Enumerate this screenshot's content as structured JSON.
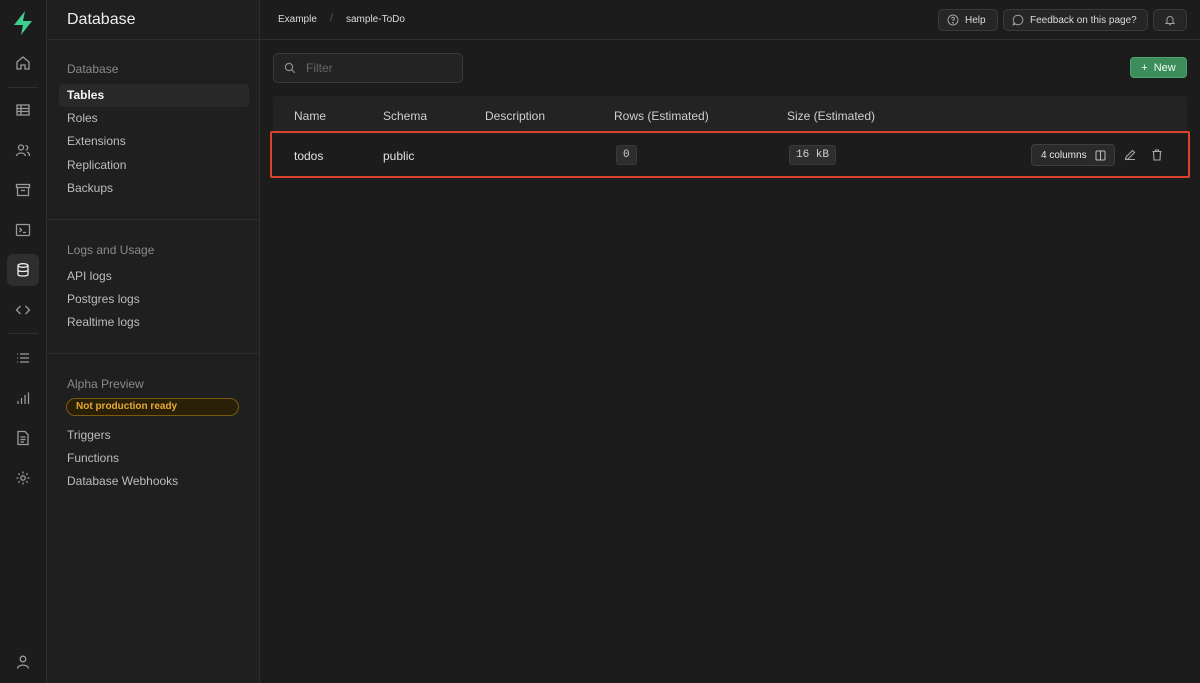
{
  "header": {
    "breadcrumb": [
      "Example",
      "sample-ToDo"
    ],
    "help_label": "Help",
    "feedback_label": "Feedback on this page?"
  },
  "sidebar": {
    "title": "Database",
    "sections": [
      {
        "title": "Database",
        "items": [
          "Tables",
          "Roles",
          "Extensions",
          "Replication",
          "Backups"
        ],
        "active": "Tables"
      },
      {
        "title": "Logs and Usage",
        "items": [
          "API logs",
          "Postgres logs",
          "Realtime logs"
        ]
      },
      {
        "title": "Alpha Preview",
        "badge": "Not production ready",
        "items": [
          "Triggers",
          "Functions",
          "Database Webhooks"
        ]
      }
    ]
  },
  "toolbar": {
    "filter_placeholder": "Filter",
    "new_label": "New"
  },
  "table": {
    "columns": [
      "Name",
      "Schema",
      "Description",
      "Rows (Estimated)",
      "Size (Estimated)"
    ],
    "rows": [
      {
        "name": "todos",
        "schema": "public",
        "description": "",
        "rows": "0",
        "size": "16 kB",
        "columns_label": "4 columns"
      }
    ]
  },
  "icons": {
    "rail": [
      "home-icon",
      "table-editor-icon",
      "auth-users-icon",
      "storage-icon",
      "sql-editor-icon",
      "database-icon",
      "api-icon",
      "logs-icon",
      "reports-icon",
      "docs-icon",
      "settings-icon",
      "account-icon"
    ]
  },
  "colors": {
    "accent": "#3ecf8e",
    "new_button": "#3d8c5c",
    "highlight_border": "#d9432a",
    "badge_text": "#e5a937"
  }
}
